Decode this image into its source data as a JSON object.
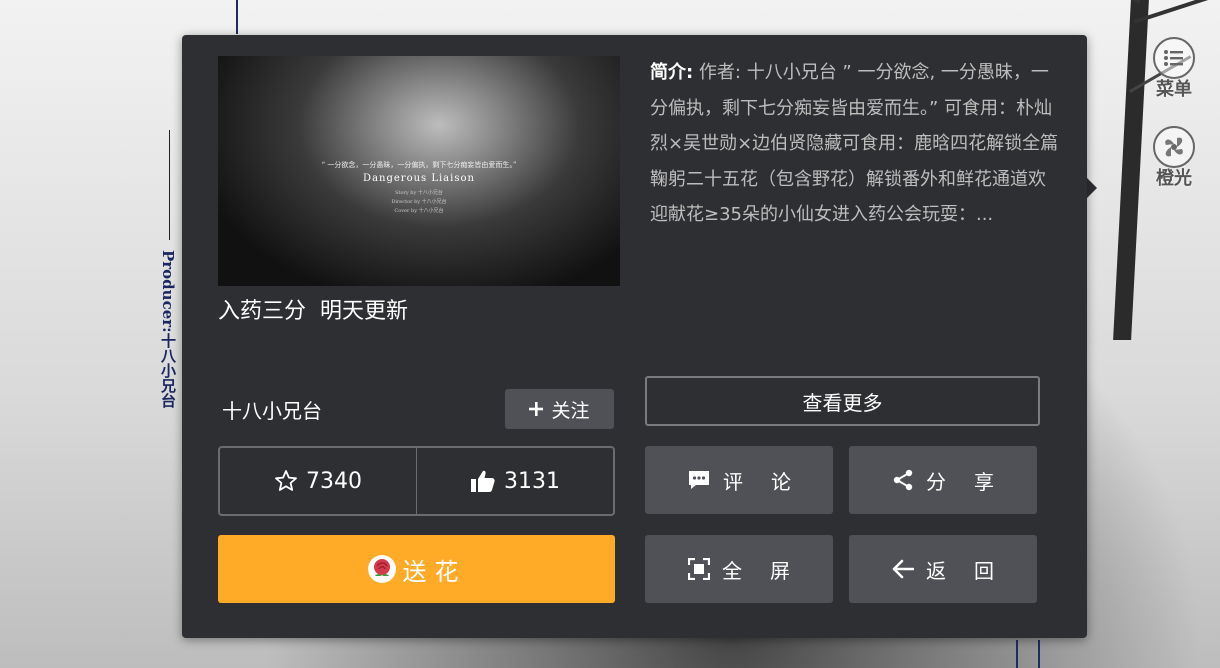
{
  "background": {
    "producer_text": "Producer:十八小兄台"
  },
  "side_menu": [
    {
      "label": "菜单",
      "icon": "menu-list-icon"
    },
    {
      "label": "橙光",
      "icon": "orange-light-icon"
    }
  ],
  "work": {
    "cover": {
      "caption_quote": "“ 一分欲念，一分愚昧，一分偏执，剩下七分痴妄皆由爱而生。”",
      "caption_title": "Dangerous Liaison",
      "caption_credits": [
        "Story by 十八小兄台",
        "Director by 十八小兄台",
        "Cover by 十八小兄台"
      ]
    },
    "title": "入药三分  明天更新",
    "summary_label": "简介:",
    "summary_text": " 作者: 十八小兄台 ” 一分欲念, 一分愚昧，一分偏执，剩下七分痴妄皆由爱而生。” 可食用：朴灿烈×吴世勋×边伯贤隐藏可食用：鹿晗四花解锁全篇鞠躬二十五花（包含野花）解锁番外和鲜花通道欢迎献花≥35朵的小仙女进入药公会玩耍：..."
  },
  "author": {
    "name": "十八小兄台",
    "follow_label": "关注"
  },
  "stats": {
    "favorites": "7340",
    "likes": "3131"
  },
  "buttons": {
    "send_flower": "送花",
    "view_more": "查看更多",
    "comment": "评论",
    "share": "分享",
    "fullscreen": "全屏",
    "back": "返回"
  },
  "colors": {
    "panel_bg": "#2e2f32",
    "button_bg": "#505156",
    "flower_button": "#ffab28"
  }
}
